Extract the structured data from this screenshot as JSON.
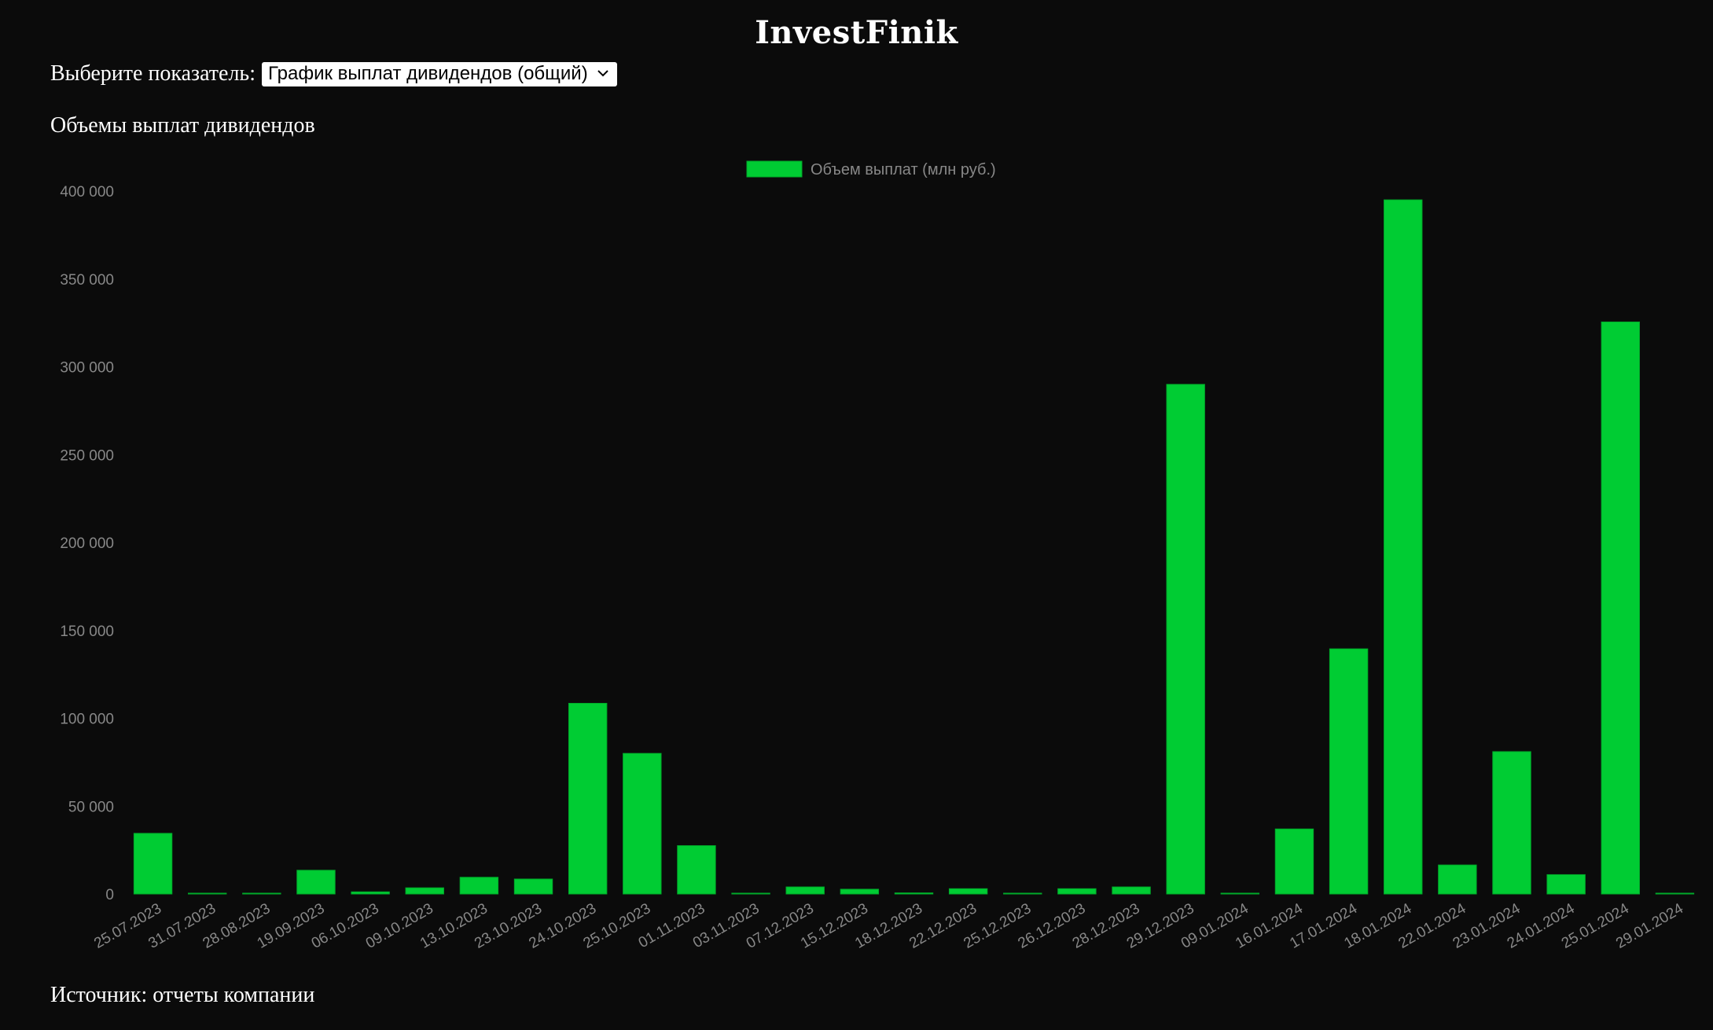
{
  "header": {
    "title": "InvestFinik"
  },
  "selector": {
    "label": "Выберите показатель:",
    "selected": "График выплат дивидендов (общий)"
  },
  "section": {
    "title": "Объемы выплат дивидендов"
  },
  "footer": {
    "source": "Источник: отчеты компании"
  },
  "colors": {
    "bar": "#00cc33",
    "background": "#0b0b0b",
    "axis_text": "#888888"
  },
  "chart_data": {
    "type": "bar",
    "legend_position": "top-center",
    "grid": false,
    "ylim": [
      0,
      400000
    ],
    "yticks": [
      0,
      50000,
      100000,
      150000,
      200000,
      250000,
      300000,
      350000,
      400000
    ],
    "ytick_labels": [
      "0",
      "50 000",
      "100 000",
      "150 000",
      "200 000",
      "250 000",
      "300 000",
      "350 000",
      "400 000"
    ],
    "categories": [
      "25.07.2023",
      "31.07.2023",
      "28.08.2023",
      "19.09.2023",
      "06.10.2023",
      "09.10.2023",
      "13.10.2023",
      "23.10.2023",
      "24.10.2023",
      "25.10.2023",
      "01.11.2023",
      "03.11.2023",
      "07.12.2023",
      "15.12.2023",
      "18.12.2023",
      "22.12.2023",
      "25.12.2023",
      "26.12.2023",
      "28.12.2023",
      "29.12.2023",
      "09.01.2024",
      "16.01.2024",
      "17.01.2024",
      "18.01.2024",
      "22.01.2024",
      "23.01.2024",
      "24.01.2024",
      "25.01.2024",
      "29.01.2024"
    ],
    "series": [
      {
        "name": "Объем выплат (млн руб.)",
        "values": [
          34500,
          300,
          300,
          13500,
          1200,
          3500,
          9500,
          8500,
          108500,
          80000,
          27500,
          300,
          4000,
          2700,
          600,
          3000,
          300,
          3000,
          4000,
          290000,
          300,
          37000,
          139500,
          395000,
          16500,
          81000,
          11000,
          325500,
          300
        ]
      }
    ]
  }
}
